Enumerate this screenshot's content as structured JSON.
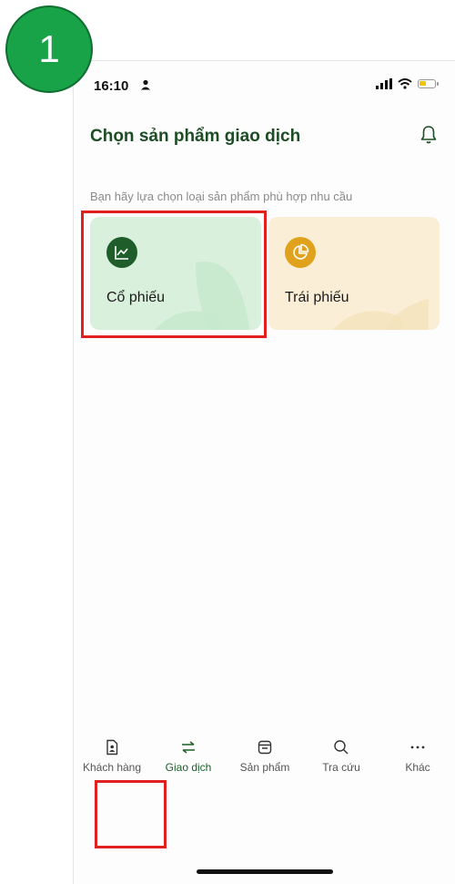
{
  "annotation": {
    "step_number": "1"
  },
  "status_bar": {
    "time": "16:10"
  },
  "header": {
    "title": "Chọn sản phẩm giao dịch"
  },
  "subtitle": "Bạn hãy lựa chọn loại sản phẩm phù hợp nhu cầu",
  "products": [
    {
      "label": "Cổ phiếu",
      "icon": "line-chart-icon",
      "color": "#1f5e2a"
    },
    {
      "label": "Trái phiếu",
      "icon": "pie-chart-icon",
      "color": "#e0a11c"
    }
  ],
  "bottom_nav": {
    "items": [
      {
        "label": "Khách hàng",
        "icon": "customer-icon",
        "active": false
      },
      {
        "label": "Giao dịch",
        "icon": "transfer-arrows-icon",
        "active": true
      },
      {
        "label": "Sản phẩm",
        "icon": "product-box-icon",
        "active": false
      },
      {
        "label": "Tra cứu",
        "icon": "search-icon",
        "active": false
      },
      {
        "label": "Khác",
        "icon": "more-dots-icon",
        "active": false
      }
    ]
  },
  "colors": {
    "brand_green": "#1d4d24",
    "highlight_red": "#e01f1f",
    "badge_green": "#18a349"
  }
}
